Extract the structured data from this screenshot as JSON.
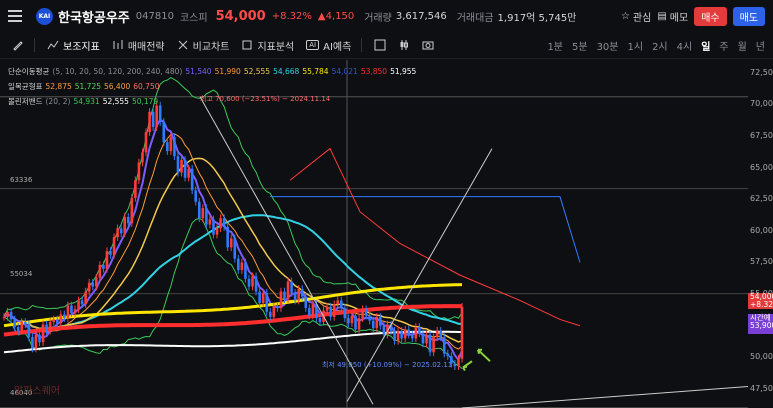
{
  "header": {
    "name": "한국항공우주",
    "code": "047810",
    "market": "코스피",
    "price": "54,000",
    "pct": "+8.32%",
    "change": "▲4,150",
    "vol_label": "거래량",
    "vol": "3,617,546",
    "amt_label": "거래대금",
    "amt": "1,917억 5,745만",
    "logo_text": "KAI",
    "fav": "관심",
    "memo": "메모",
    "buy": "매수",
    "sell": "매도"
  },
  "toolbar": {
    "items": [
      "보조지표",
      "매매전략",
      "비교차트",
      "지표분석",
      "AI예측"
    ],
    "ai_badge": "AI",
    "timeframes": [
      "1분",
      "5분",
      "30분",
      "1시",
      "2시",
      "4시",
      "일",
      "주",
      "월",
      "년"
    ],
    "selected": "일"
  },
  "legends": [
    {
      "name": "단순이동평균",
      "params": "(5, 10, 20, 50, 120, 200, 240, 480)",
      "values": [
        {
          "v": "51,540",
          "c": "#7b5cff"
        },
        {
          "v": "51,990",
          "c": "#ff9a3c"
        },
        {
          "v": "52,555",
          "c": "#f2c94c"
        },
        {
          "v": "54,668",
          "c": "#32d2e6"
        },
        {
          "v": "55,784",
          "c": "#ffe600"
        },
        {
          "v": "54,021",
          "c": "#2f55d4"
        },
        {
          "v": "53,850",
          "c": "#ff2e2e"
        },
        {
          "v": "51,955",
          "c": "#ffffff"
        }
      ]
    },
    {
      "name": "일목균형표",
      "params": "",
      "values": [
        {
          "v": "52,875",
          "c": "#ff9a3c"
        },
        {
          "v": "51,725",
          "c": "#5ad35a"
        },
        {
          "v": "56,400",
          "c": "#ff9a3c"
        },
        {
          "v": "60,750",
          "c": "#ff6b6b"
        }
      ]
    },
    {
      "name": "볼린저밴드",
      "params": "(20, 2)",
      "values": [
        {
          "v": "54,931",
          "c": "#3cc85a"
        },
        {
          "v": "52,555",
          "c": "#ffffff"
        },
        {
          "v": "50,179",
          "c": "#3cc85a"
        }
      ]
    }
  ],
  "yaxis": [
    "72,500",
    "70,000",
    "67,500",
    "65,000",
    "62,500",
    "60,000",
    "57,500",
    "55,000",
    "52,500",
    "50,000",
    "47,500"
  ],
  "annotations": {
    "high": "최고 70,600 (−23.51%) − 2024.11.14",
    "low": "최저 49,050 (+10.09%) − 2025.02.11",
    "level1": "63336",
    "level2": "55034",
    "level3": "46040",
    "watermark": "알파스퀘어"
  },
  "price_tags": {
    "current": "54,000",
    "current_pct": "+8.32%",
    "timer": "시간예",
    "base": "53,900"
  },
  "chart_data": {
    "type": "candlestick",
    "ylim": [
      46000,
      73500
    ],
    "grid": false,
    "close": [
      53200,
      53600,
      53000,
      52400,
      52100,
      52800,
      52600,
      51600,
      50700,
      51800,
      51200,
      52600,
      52100,
      52800,
      53000,
      52700,
      53400,
      53100,
      54100,
      53500,
      53800,
      54500,
      54200,
      55200,
      55900,
      55600,
      56300,
      57300,
      57000,
      58400,
      58100,
      59500,
      60200,
      59800,
      61100,
      60600,
      62600,
      64000,
      65400,
      66200,
      67800,
      69400,
      68200,
      69900,
      68600,
      67000,
      66300,
      67400,
      65900,
      64600,
      65600,
      64200,
      64900,
      63200,
      62300,
      61000,
      61800,
      60500,
      60900,
      59700,
      60200,
      61000,
      60300,
      58700,
      59400,
      57800,
      56900,
      57500,
      56200,
      55600,
      56400,
      55200,
      54300,
      55100,
      53600,
      53200,
      54000,
      53900,
      55200,
      54600,
      56000,
      55100,
      54500,
      55400,
      54800,
      53900,
      53300,
      54200,
      53100,
      52800,
      53700,
      54000,
      53200,
      54200,
      54500,
      53900,
      53100,
      52700,
      53300,
      52200,
      53100,
      53800,
      53300,
      52900,
      52300,
      53200,
      52500,
      51800,
      52600,
      52100,
      51300,
      52100,
      51500,
      52200,
      51800,
      51500,
      52400,
      51900,
      51100,
      51800,
      50400,
      51600,
      52100,
      51600,
      50300,
      50100,
      49500,
      49300,
      49900,
      54000
    ],
    "ma5_last": 51540,
    "ma200_last": 54021,
    "ma480_last": 51955
  }
}
